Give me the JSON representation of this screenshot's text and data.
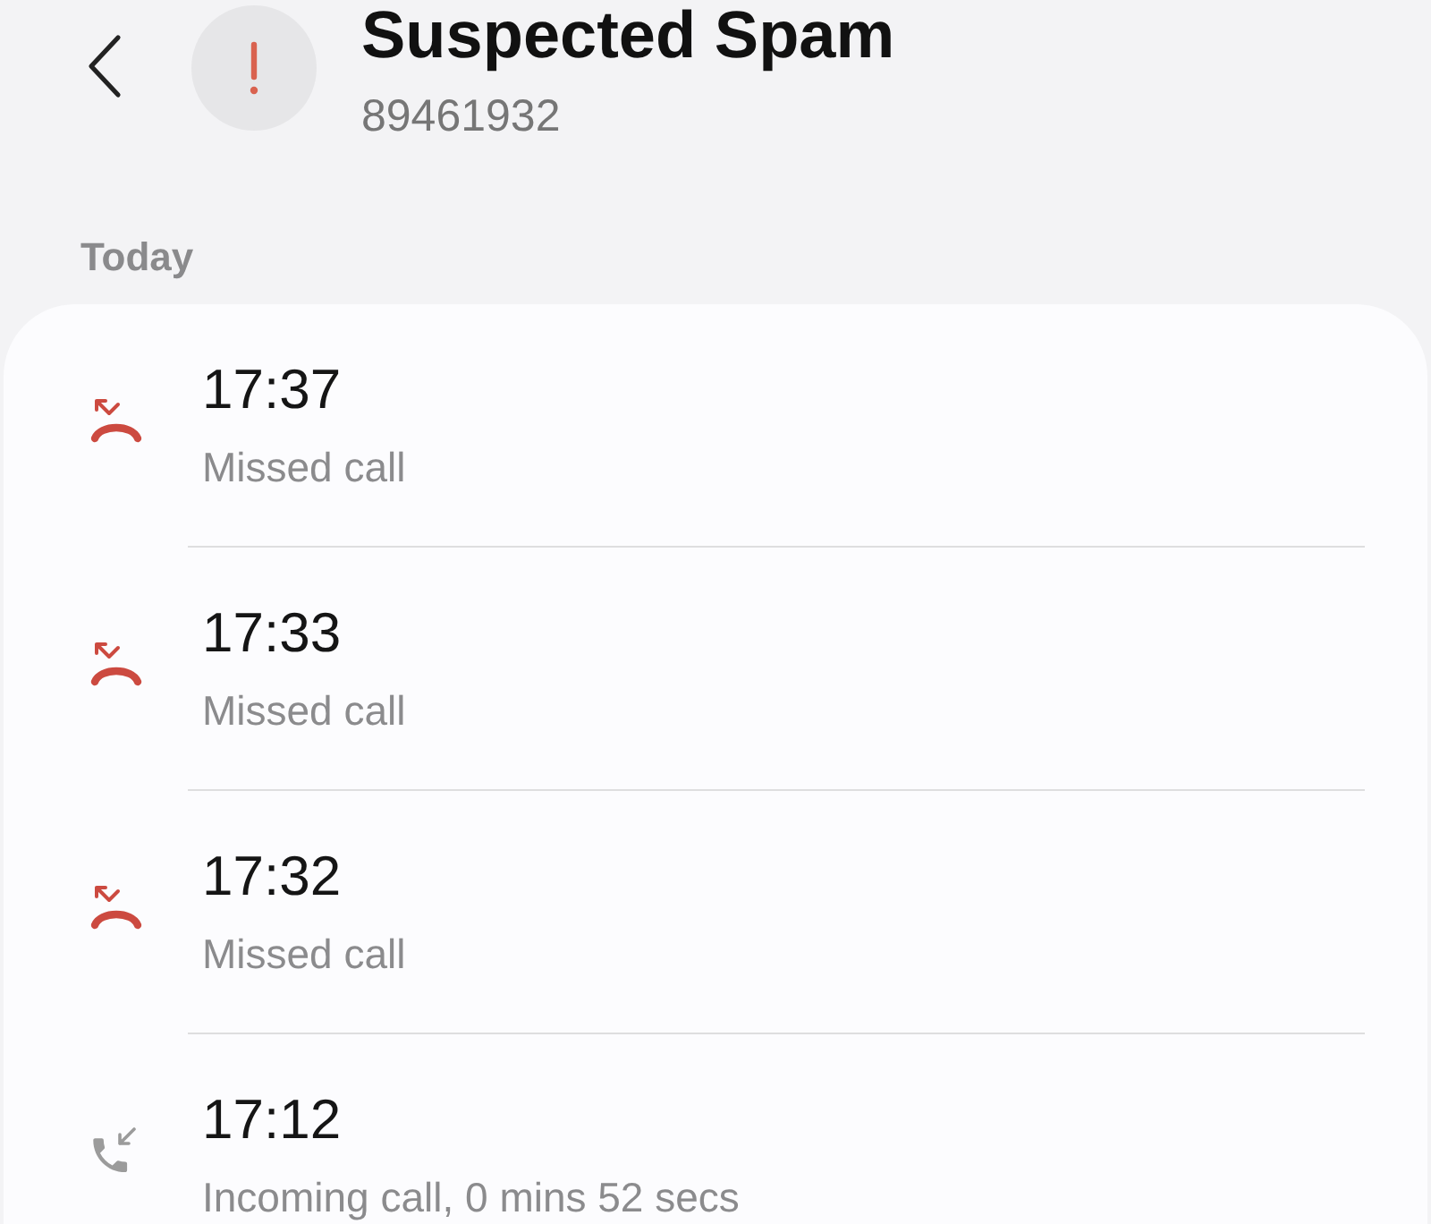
{
  "header": {
    "title": "Suspected Spam",
    "number": "89461932"
  },
  "section_label": "Today",
  "calls": [
    {
      "kind": "missed",
      "time": "17:37",
      "description": "Missed call"
    },
    {
      "kind": "missed",
      "time": "17:33",
      "description": "Missed call"
    },
    {
      "kind": "missed",
      "time": "17:32",
      "description": "Missed call"
    },
    {
      "kind": "incoming",
      "time": "17:12",
      "description": "Incoming call, 0 mins 52 secs"
    }
  ]
}
